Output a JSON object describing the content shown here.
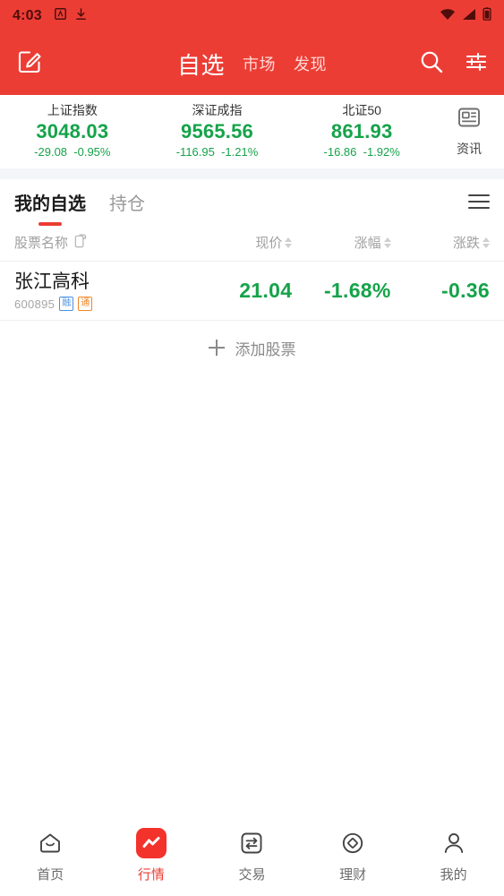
{
  "theme": {
    "brand_red": "#ec3d35",
    "down_green": "#15a349",
    "muted": "#9a9a9a"
  },
  "statusbar": {
    "time": "4:03",
    "icons": [
      "app-badge-icon",
      "download-icon",
      "wifi-icon",
      "signal-icon",
      "battery-icon"
    ]
  },
  "header": {
    "edit_icon": "edit-compose-icon",
    "tabs": [
      {
        "label": "自选",
        "active": true
      },
      {
        "label": "市场",
        "active": false
      },
      {
        "label": "发现",
        "active": false
      }
    ],
    "search_icon": "search-icon",
    "filter_icon": "sliders-icon"
  },
  "indices": [
    {
      "name": "上证指数",
      "value": "3048.03",
      "change": "-29.08",
      "percent": "-0.95%"
    },
    {
      "name": "深证成指",
      "value": "9565.56",
      "change": "-116.95",
      "percent": "-1.21%"
    },
    {
      "name": "北证50",
      "value": "861.93",
      "change": "-16.86",
      "percent": "-1.92%"
    }
  ],
  "news_button": {
    "label": "资讯",
    "icon": "news-card-icon"
  },
  "subtabs": [
    {
      "label": "我的自选",
      "active": true
    },
    {
      "label": "持仓",
      "active": false
    }
  ],
  "list_menu_icon": "hamburger-menu-icon",
  "columns": [
    {
      "label": "股票名称",
      "sortable": false,
      "icon": "swap-layout-icon"
    },
    {
      "label": "现价",
      "sortable": true
    },
    {
      "label": "涨幅",
      "sortable": true
    },
    {
      "label": "涨跌",
      "sortable": true
    }
  ],
  "stocks": [
    {
      "name": "张江高科",
      "code": "600895",
      "badges": [
        {
          "label": "融",
          "color": "#4a90e2"
        },
        {
          "label": "通",
          "color": "#f0862a"
        }
      ],
      "price": "21.04",
      "percent": "-1.68%",
      "change": "-0.36"
    }
  ],
  "add_stock": {
    "label": "添加股票",
    "icon": "plus-icon"
  },
  "bottomnav": [
    {
      "label": "首页",
      "icon": "home-icon",
      "active": false
    },
    {
      "label": "行情",
      "icon": "market-chart-icon",
      "active": true
    },
    {
      "label": "交易",
      "icon": "trade-exchange-icon",
      "active": false
    },
    {
      "label": "理财",
      "icon": "finance-coin-icon",
      "active": false
    },
    {
      "label": "我的",
      "icon": "profile-person-icon",
      "active": false
    }
  ]
}
